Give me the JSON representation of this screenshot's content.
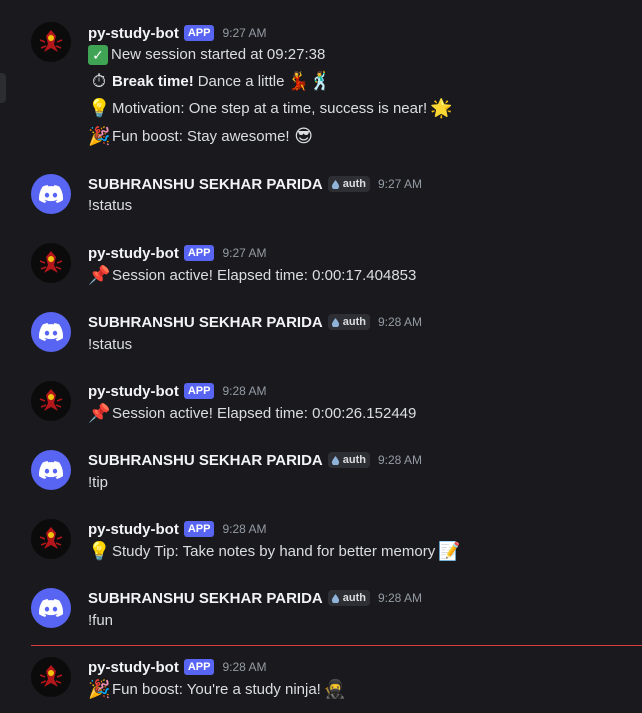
{
  "colors": {
    "background": "#1a1a1e",
    "app_badge": "#5865f2",
    "user_avatar": "#5865f2",
    "new_divider": "#d83c3e"
  },
  "bot_name": "py-study-bot",
  "app_badge": "APP",
  "user_name": "SUBHRANSHU SEKHAR PARIDA",
  "auth_badge": "auth",
  "messages": [
    {
      "time": "9:27 AM",
      "lines": [
        {
          "icon": "check-mark-icon",
          "text": "New session started at 09:27:38"
        },
        {
          "icon": "stopwatch-icon",
          "bold": "Break time!",
          "text": "Dance a little",
          "tail": "dancer-icon"
        },
        {
          "icon": "lightbulb-icon",
          "text": "Motivation: One step at a time, success is near!",
          "tail": "sparkle-icon"
        },
        {
          "icon": "party-popper-icon",
          "text": "Fun boost: Stay awesome!",
          "tail": "sunglasses-face-icon"
        }
      ]
    },
    {
      "time": "9:27 AM",
      "text": "!status"
    },
    {
      "time": "9:27 AM",
      "icon": "pushpin-icon",
      "text": "Session active! Elapsed time: 0:00:17.404853"
    },
    {
      "time": "9:28 AM",
      "text": "!status"
    },
    {
      "time": "9:28 AM",
      "icon": "pushpin-icon",
      "text": "Session active! Elapsed time: 0:00:26.152449"
    },
    {
      "time": "9:28 AM",
      "text": "!tip"
    },
    {
      "time": "9:28 AM",
      "icon": "lightbulb-icon",
      "text": "Study Tip: Take notes by hand for better memory",
      "tail": "memo-icon"
    },
    {
      "time": "9:28 AM",
      "text": "!fun"
    },
    {
      "time": "9:28 AM",
      "icon": "party-popper-icon",
      "text": "Fun boost: You're a study ninja!",
      "tail": "ninja-icon"
    }
  ]
}
